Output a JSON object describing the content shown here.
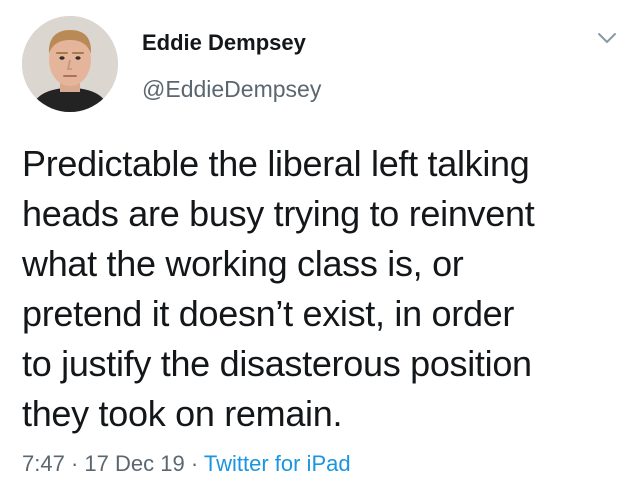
{
  "author": {
    "display_name": "Eddie Dempsey",
    "handle": "@EddieDempsey",
    "avatar_icon": "profile-photo"
  },
  "tweet": {
    "lines": [
      "Predictable the liberal left talking",
      "heads are busy trying to reinvent",
      "what the working class is, or",
      "pretend it doesn’t exist, in order",
      "to justify the disasterous position",
      "they took on remain."
    ]
  },
  "meta": {
    "time": "7:47",
    "separator": "·",
    "date": "17 Dec 19",
    "source": "Twitter for iPad"
  },
  "menu": {
    "icon": "chevron-down-icon"
  },
  "colors": {
    "text": "#14171a",
    "secondary": "#5b6770",
    "link": "#1b95e0",
    "chevron": "#8899a6"
  }
}
